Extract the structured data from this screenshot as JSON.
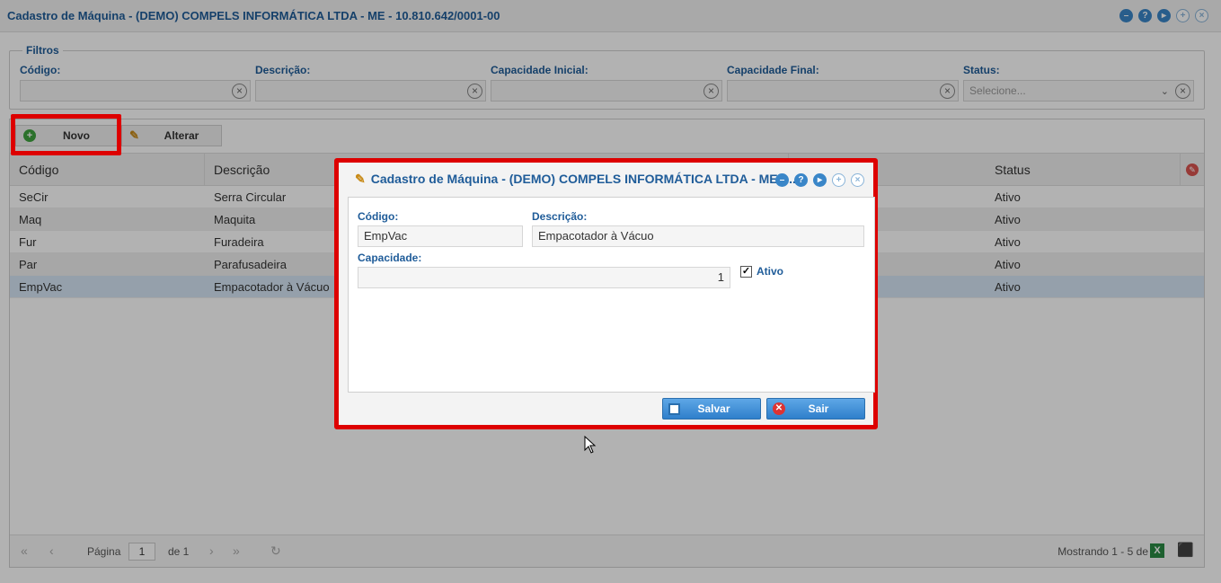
{
  "window": {
    "title": "Cadastro de Máquina - (DEMO) COMPELS INFORMÁTICA LTDA - ME - 10.810.642/0001-00"
  },
  "filters": {
    "legend": "Filtros",
    "codigo_label": "Código:",
    "descricao_label": "Descrição:",
    "cap_inicial_label": "Capacidade Inicial:",
    "cap_final_label": "Capacidade Final:",
    "status_label": "Status:",
    "status_placeholder": "Selecione..."
  },
  "toolbar": {
    "novo_label": "Novo",
    "alterar_label": "Alterar"
  },
  "grid": {
    "columns": [
      "Código",
      "Descrição",
      "Status"
    ],
    "rows": [
      {
        "codigo": "SeCir",
        "descricao": "Serra Circular",
        "status": "Ativo"
      },
      {
        "codigo": "Maq",
        "descricao": "Maquita",
        "status": "Ativo"
      },
      {
        "codigo": "Fur",
        "descricao": "Furadeira",
        "status": "Ativo"
      },
      {
        "codigo": "Par",
        "descricao": "Parafusadeira",
        "status": "Ativo"
      },
      {
        "codigo": "EmpVac",
        "descricao": "Empacotador à Vácuo",
        "status": "Ativo"
      }
    ]
  },
  "pager": {
    "page_label": "Página",
    "page_value": "1",
    "of_label": "de 1",
    "showing": "Mostrando 1 - 5 de 5"
  },
  "dialog": {
    "title": "Cadastro de Máquina - (DEMO) COMPELS INFORMÁTICA LTDA - ME -...",
    "codigo_label": "Código:",
    "codigo_value": "EmpVac",
    "descricao_label": "Descrição:",
    "descricao_value": "Empacotador à Vácuo",
    "capacidade_label": "Capacidade:",
    "capacidade_value": "1",
    "ativo_label": "Ativo",
    "save_label": "Salvar",
    "exit_label": "Sair"
  },
  "colors": {
    "accent": "#1f5c99",
    "highlight": "#dd0000",
    "button": "#3a86c8"
  }
}
